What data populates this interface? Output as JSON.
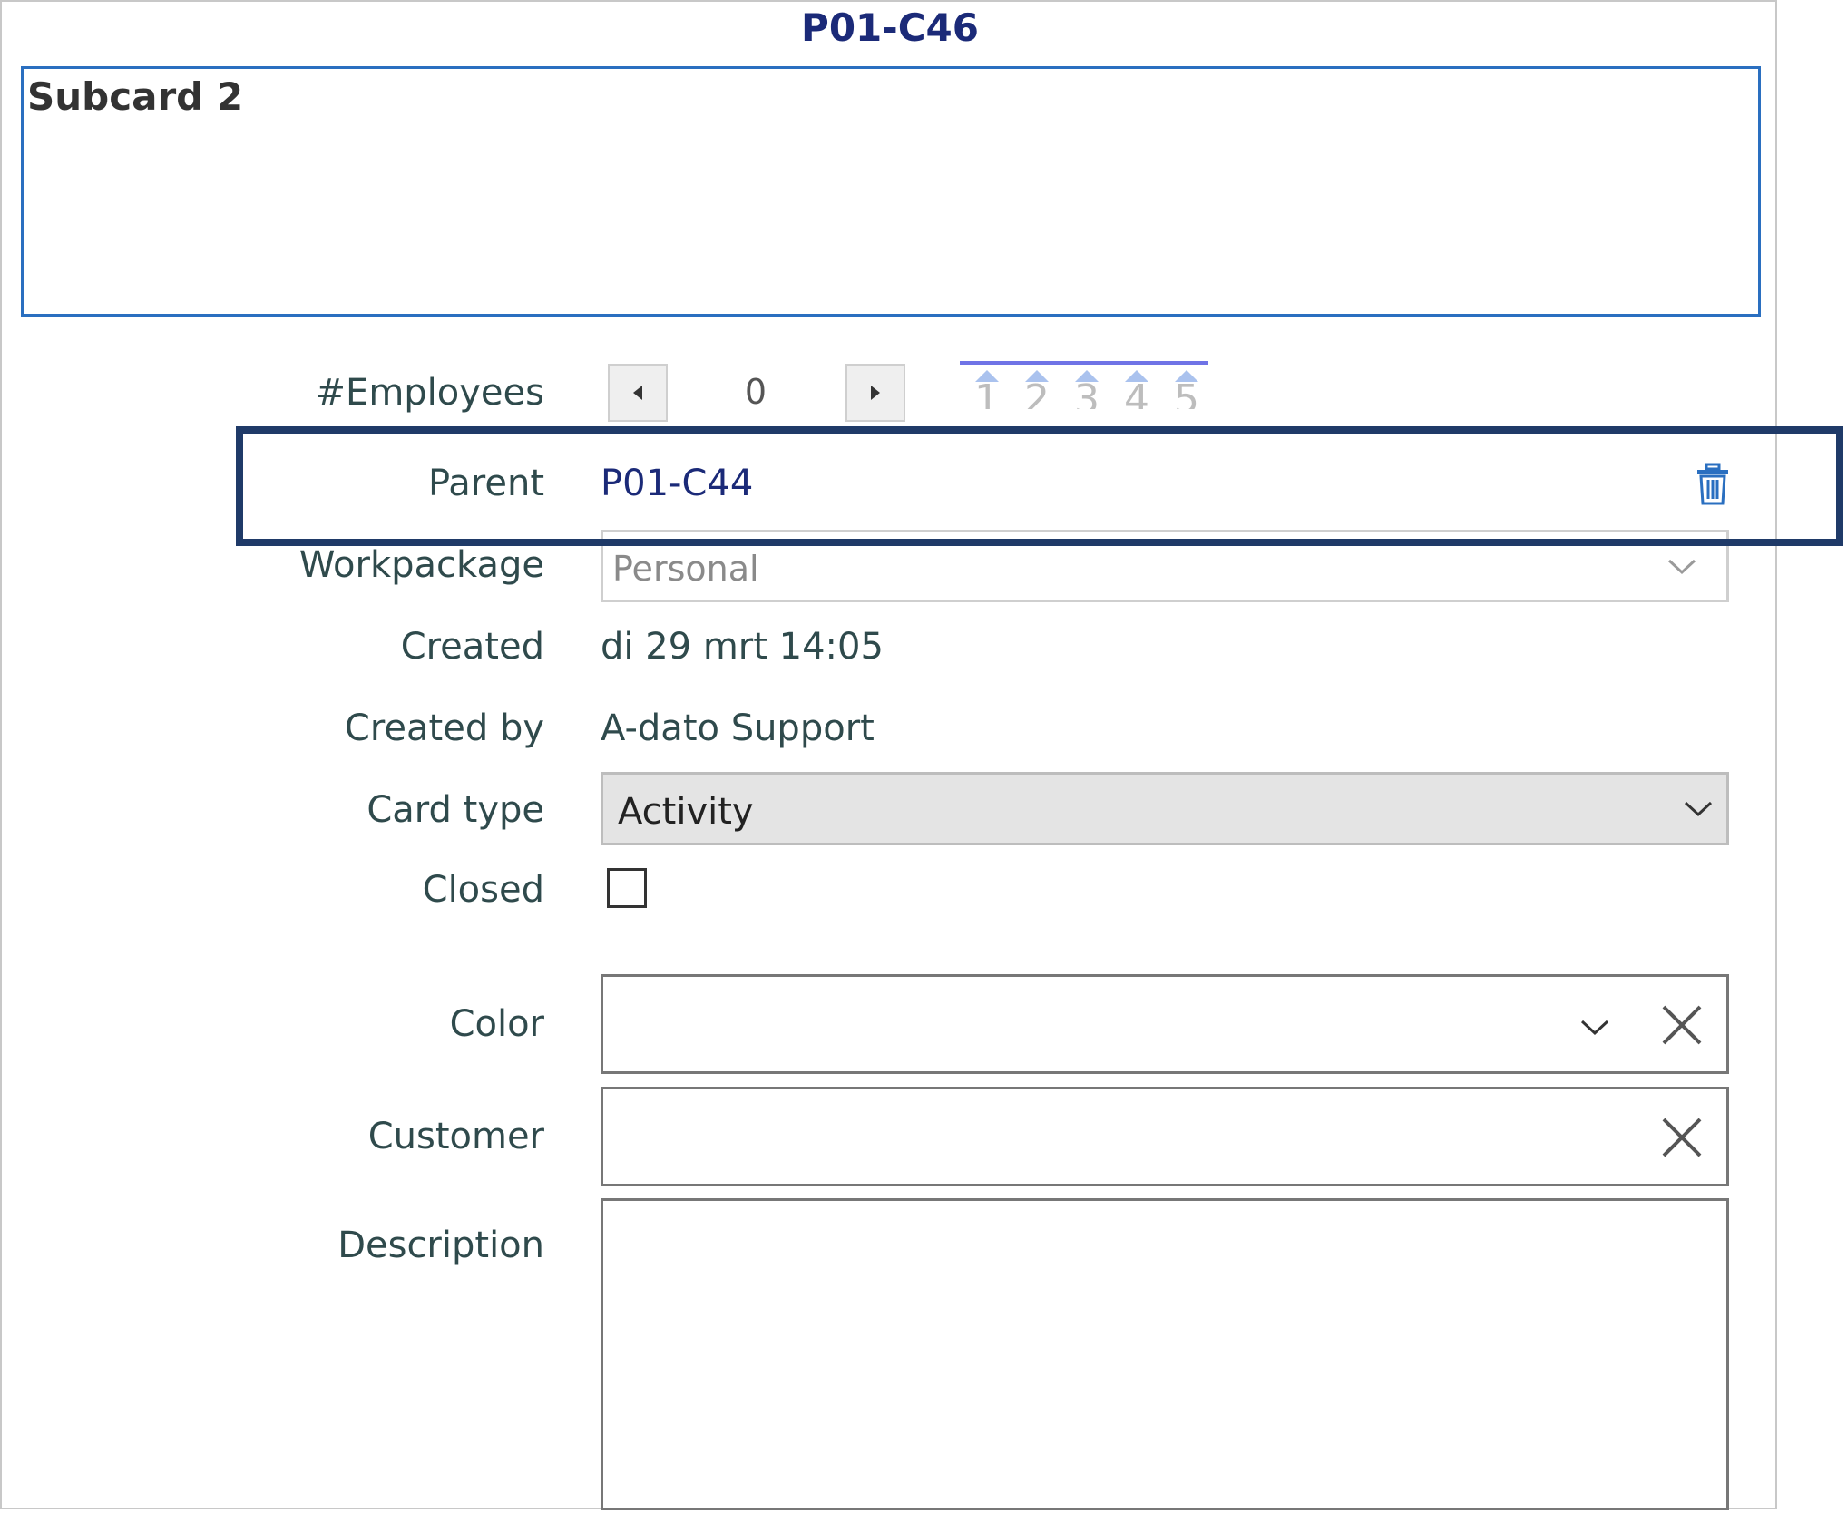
{
  "card": {
    "id": "P01-C46",
    "title": "Subcard 2"
  },
  "fields": {
    "employees": {
      "label": "#Employees",
      "value": "0",
      "scale": [
        "1",
        "2",
        "3",
        "4",
        "5"
      ]
    },
    "parent": {
      "label": "Parent",
      "value": "P01-C44",
      "delete_icon": "trash-icon"
    },
    "workpackage": {
      "label": "Workpackage",
      "value": "Personal"
    },
    "created": {
      "label": "Created",
      "value": "di 29 mrt 14:05"
    },
    "created_by": {
      "label": "Created by",
      "value": "A-dato Support"
    },
    "card_type": {
      "label": "Card type",
      "value": "Activity"
    },
    "closed": {
      "label": "Closed",
      "checked": false
    },
    "color": {
      "label": "Color",
      "value": ""
    },
    "customer": {
      "label": "Customer",
      "value": ""
    },
    "description": {
      "label": "Description",
      "value": ""
    }
  },
  "colors": {
    "card_id": "#1b2a78",
    "title_border": "#2a6fc0",
    "highlight_border": "#1f3a68",
    "label_text": "#2f4a4c",
    "scale_line": "#6f73e6",
    "trash_icon": "#2a6fc0"
  }
}
